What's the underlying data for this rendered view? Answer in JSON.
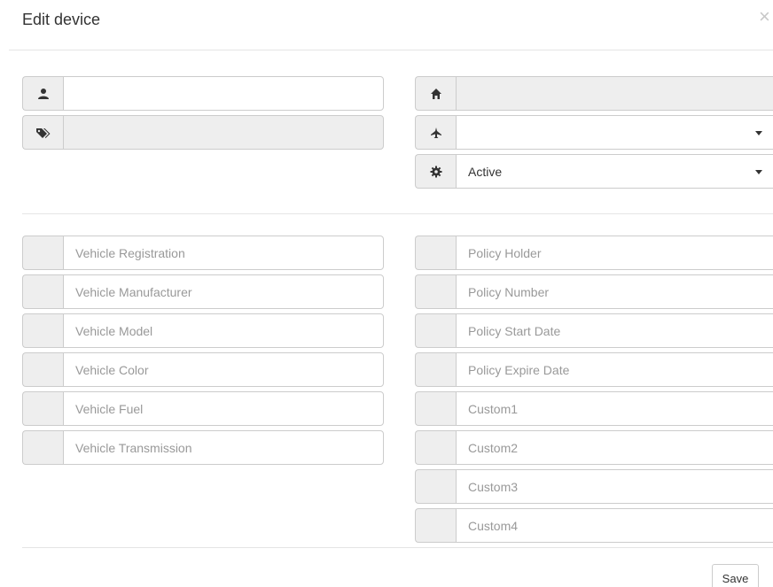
{
  "modal": {
    "title": "Edit device",
    "close_label": "×",
    "save_label": "Save"
  },
  "top_left": {
    "user_field": {
      "icon": "user-icon",
      "value": ""
    },
    "tags_field": {
      "icon": "tags-icon",
      "value": ""
    }
  },
  "top_right": {
    "home_field": {
      "icon": "home-icon",
      "value": ""
    },
    "plane_select": {
      "icon": "plane-icon",
      "value": ""
    },
    "status_select": {
      "icon": "gear-icon",
      "value": "Active"
    }
  },
  "vehicle_fields": [
    {
      "placeholder": "Vehicle Registration"
    },
    {
      "placeholder": "Vehicle Manufacturer"
    },
    {
      "placeholder": "Vehicle Model"
    },
    {
      "placeholder": "Vehicle Color"
    },
    {
      "placeholder": "Vehicle Fuel"
    },
    {
      "placeholder": "Vehicle Transmission"
    }
  ],
  "policy_fields": [
    {
      "placeholder": "Policy Holder"
    },
    {
      "placeholder": "Policy Number"
    },
    {
      "placeholder": "Policy Start Date"
    },
    {
      "placeholder": "Policy Expire Date"
    },
    {
      "placeholder": "Custom1"
    },
    {
      "placeholder": "Custom2"
    },
    {
      "placeholder": "Custom3"
    },
    {
      "placeholder": "Custom4"
    }
  ],
  "colors": {
    "addon_bg": "#eeeeee",
    "border": "#cccccc",
    "placeholder": "#999999"
  }
}
